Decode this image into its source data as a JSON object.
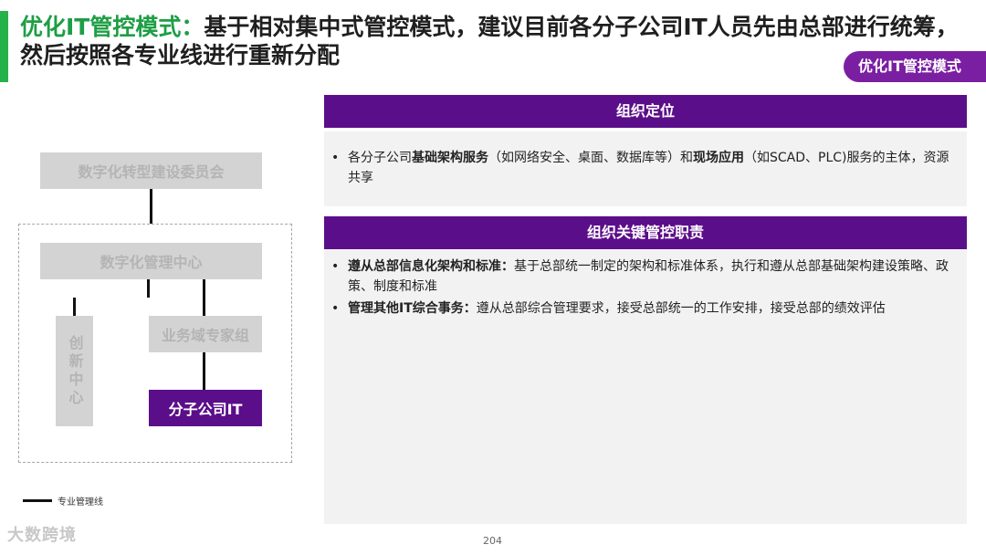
{
  "title": {
    "highlight": "优化IT管控模式：",
    "text": "基于相对集中式管控模式，建议目前各分子公司IT人员先由总部进行统筹，然后按照各专业线进行重新分配"
  },
  "tag": "优化IT管控模式",
  "org": {
    "committee": "数字化转型建设委员会",
    "center": "数字化管理中心",
    "innovation": "创新中心",
    "expert_group": "业务域专家组",
    "subsidiary_it": "分子公司IT"
  },
  "legend": "专业管理线",
  "sections": {
    "positioning": {
      "header": "组织定位",
      "bullet": "•",
      "p1": "各分子公司",
      "b1": "基础架构服务",
      "p2": "（如网络安全、桌面、数据库等）和",
      "b2": "现场应用",
      "p3": "（如SCAD、PLC)服务的主体，资源共享"
    },
    "responsibilities": {
      "header": "组织关键管控职责",
      "items": [
        {
          "bullet": "•",
          "bold": "遵从总部信息化架构和标准：",
          "text": "基于总部统一制定的架构和标准体系，执行和遵从总部基础架构建设策略、政策、制度和标准"
        },
        {
          "bullet": "•",
          "bold": "管理其他IT综合事务：",
          "text": "遵从总部综合管理要求，接受总部统一的工作安排，接受总部的绩效评估"
        }
      ]
    }
  },
  "page_number": "204",
  "watermark": "大数跨境",
  "colors": {
    "accent_green": "#26b24b",
    "purple": "#5b0e8a",
    "pill_purple": "#7b1fa2",
    "gray_box": "#d3d3d3"
  }
}
